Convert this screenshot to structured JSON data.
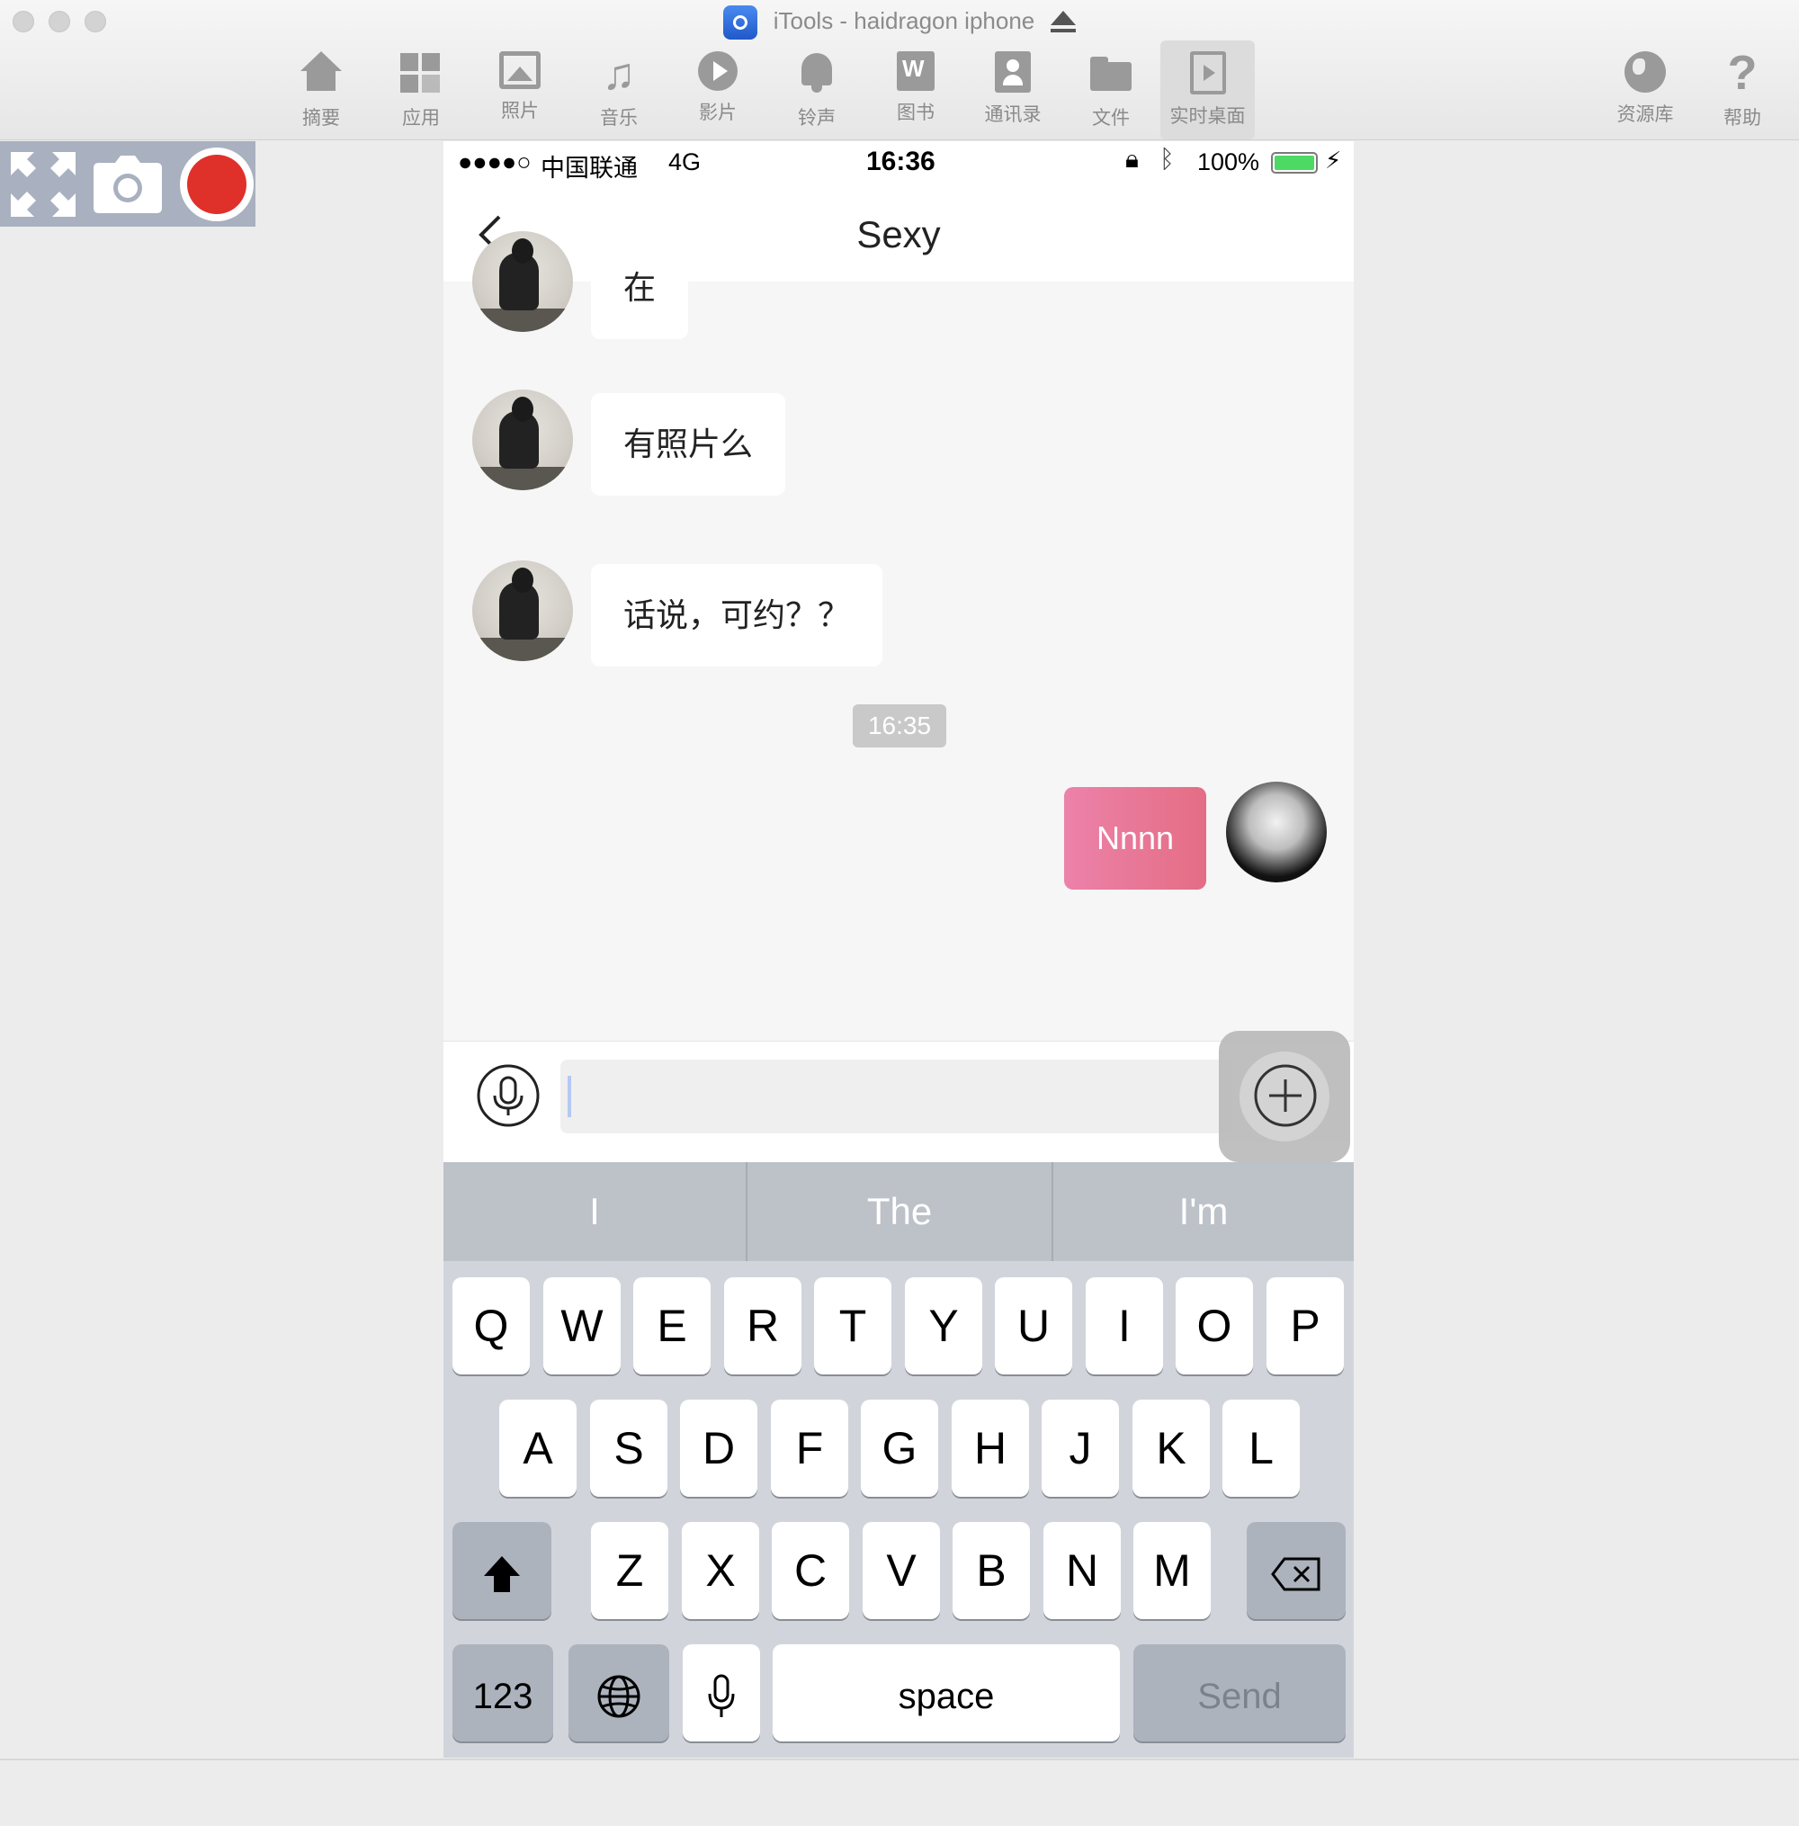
{
  "window": {
    "title": "iTools - haidragon iphone"
  },
  "toolbar": {
    "items": [
      {
        "label": "摘要",
        "icon": "home-icon"
      },
      {
        "label": "应用",
        "icon": "apps-icon"
      },
      {
        "label": "照片",
        "icon": "photo-icon"
      },
      {
        "label": "音乐",
        "icon": "music-icon"
      },
      {
        "label": "影片",
        "icon": "play-icon"
      },
      {
        "label": "铃声",
        "icon": "bell-icon"
      },
      {
        "label": "图书",
        "icon": "book-icon"
      },
      {
        "label": "通讯录",
        "icon": "contacts-icon"
      },
      {
        "label": "文件",
        "icon": "folder-icon"
      },
      {
        "label": "实时桌面",
        "icon": "screen-icon",
        "active": true
      },
      {
        "label": "资源库",
        "icon": "globe-icon"
      },
      {
        "label": "帮助",
        "icon": "help-icon"
      }
    ]
  },
  "controls": {
    "icons": [
      "fullscreen-icon",
      "camera-icon",
      "record-icon"
    ],
    "record_color": "#e0302a"
  },
  "phone": {
    "status": {
      "signal": "●●●●○",
      "carrier": "中国联通",
      "network": "4G",
      "time": "16:36",
      "battery": "100%"
    },
    "nav": {
      "title": "Sexy"
    },
    "messages": [
      {
        "from": "them",
        "text": "在"
      },
      {
        "from": "them",
        "text": "有照片么"
      },
      {
        "from": "them",
        "text": "话说，可约？？"
      },
      {
        "from": "me",
        "text": "Nnnn"
      }
    ],
    "timestamp": "16:35",
    "me_bubble_color": "#e9799b",
    "suggestions": [
      "I",
      "The",
      "I'm"
    ],
    "keyboard": {
      "row1": [
        "Q",
        "W",
        "E",
        "R",
        "T",
        "Y",
        "U",
        "I",
        "O",
        "P"
      ],
      "row2": [
        "A",
        "S",
        "D",
        "F",
        "G",
        "H",
        "J",
        "K",
        "L"
      ],
      "row3": [
        "Z",
        "X",
        "C",
        "V",
        "B",
        "N",
        "M"
      ],
      "numbers_label": "123",
      "space_label": "space",
      "send_label": "Send"
    }
  }
}
